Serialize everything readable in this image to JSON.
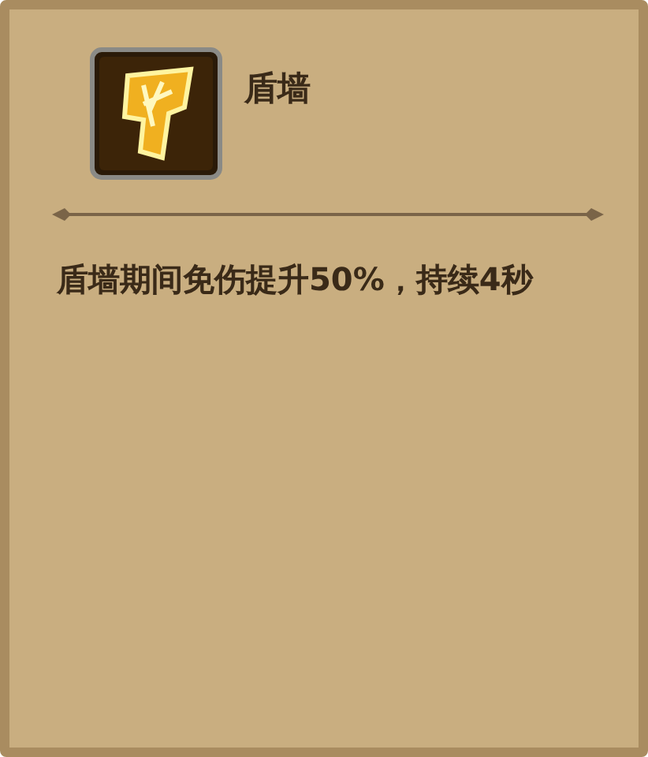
{
  "skill": {
    "name": "盾墙",
    "description": "盾墙期间免伤提升50%，持续4秒"
  }
}
